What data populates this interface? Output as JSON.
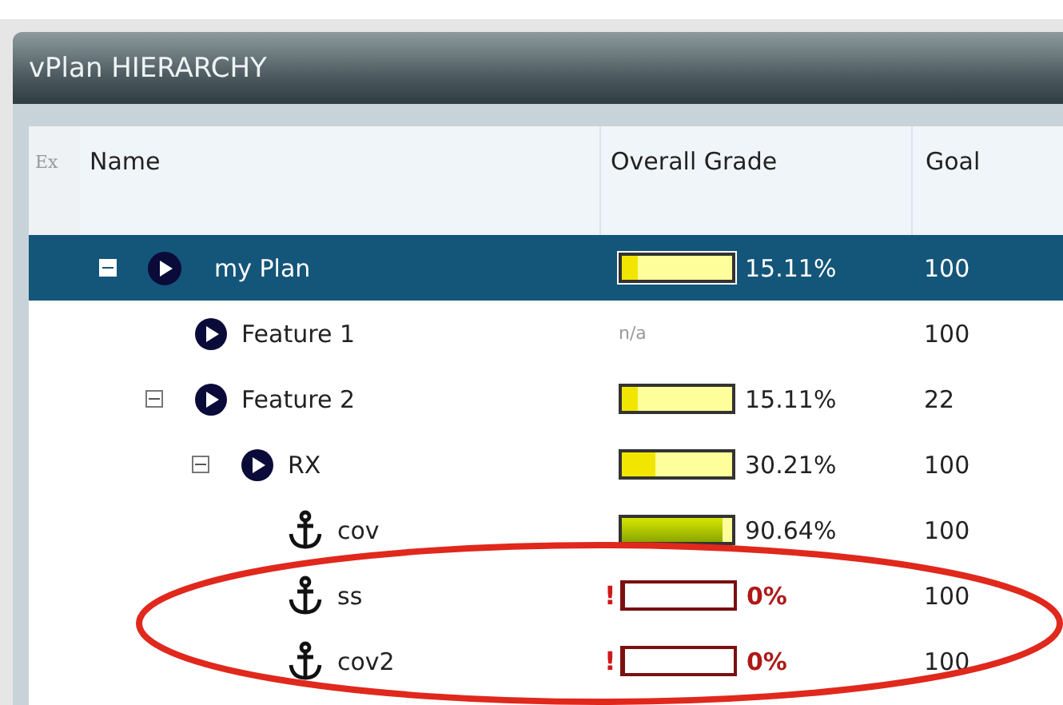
{
  "panel": {
    "title": "vPlan HIERARCHY"
  },
  "columns": {
    "ex": "Ex",
    "name": "Name",
    "grade": "Overall Grade",
    "goal": "Goal"
  },
  "tree": [
    {
      "name": "my Plan",
      "kind": "plan",
      "selected": true,
      "expanded": true,
      "grade": {
        "level": 0.15,
        "text": "15.11%"
      },
      "goal": "100",
      "children": [
        {
          "name": "Feature 1",
          "kind": "plan",
          "selected": false,
          "grade": {
            "text": "n/a"
          },
          "goal": "100"
        },
        {
          "name": "Feature 2",
          "kind": "plan",
          "selected": false,
          "expanded": true,
          "grade": {
            "level": 0.15,
            "text": "15.11%"
          },
          "goal": "22",
          "children": [
            {
              "name": "RX",
              "kind": "plan",
              "selected": false,
              "expanded": true,
              "grade": {
                "level": 0.3,
                "text": "30.21%"
              },
              "goal": "100",
              "children": [
                {
                  "name": "cov",
                  "kind": "anchor",
                  "selected": false,
                  "grade": {
                    "level": 0.91,
                    "text": "90.64%"
                  },
                  "goal": "100"
                },
                {
                  "name": "ss",
                  "kind": "anchor",
                  "selected": false,
                  "grade": {
                    "level": 0,
                    "text": "0%",
                    "alert": "!"
                  },
                  "goal": "100"
                },
                {
                  "name": "cov2",
                  "kind": "anchor",
                  "selected": false,
                  "grade": {
                    "level": 0,
                    "text": "0%",
                    "alert": "!"
                  },
                  "goal": "100"
                }
              ]
            }
          ]
        }
      ]
    }
  ]
}
